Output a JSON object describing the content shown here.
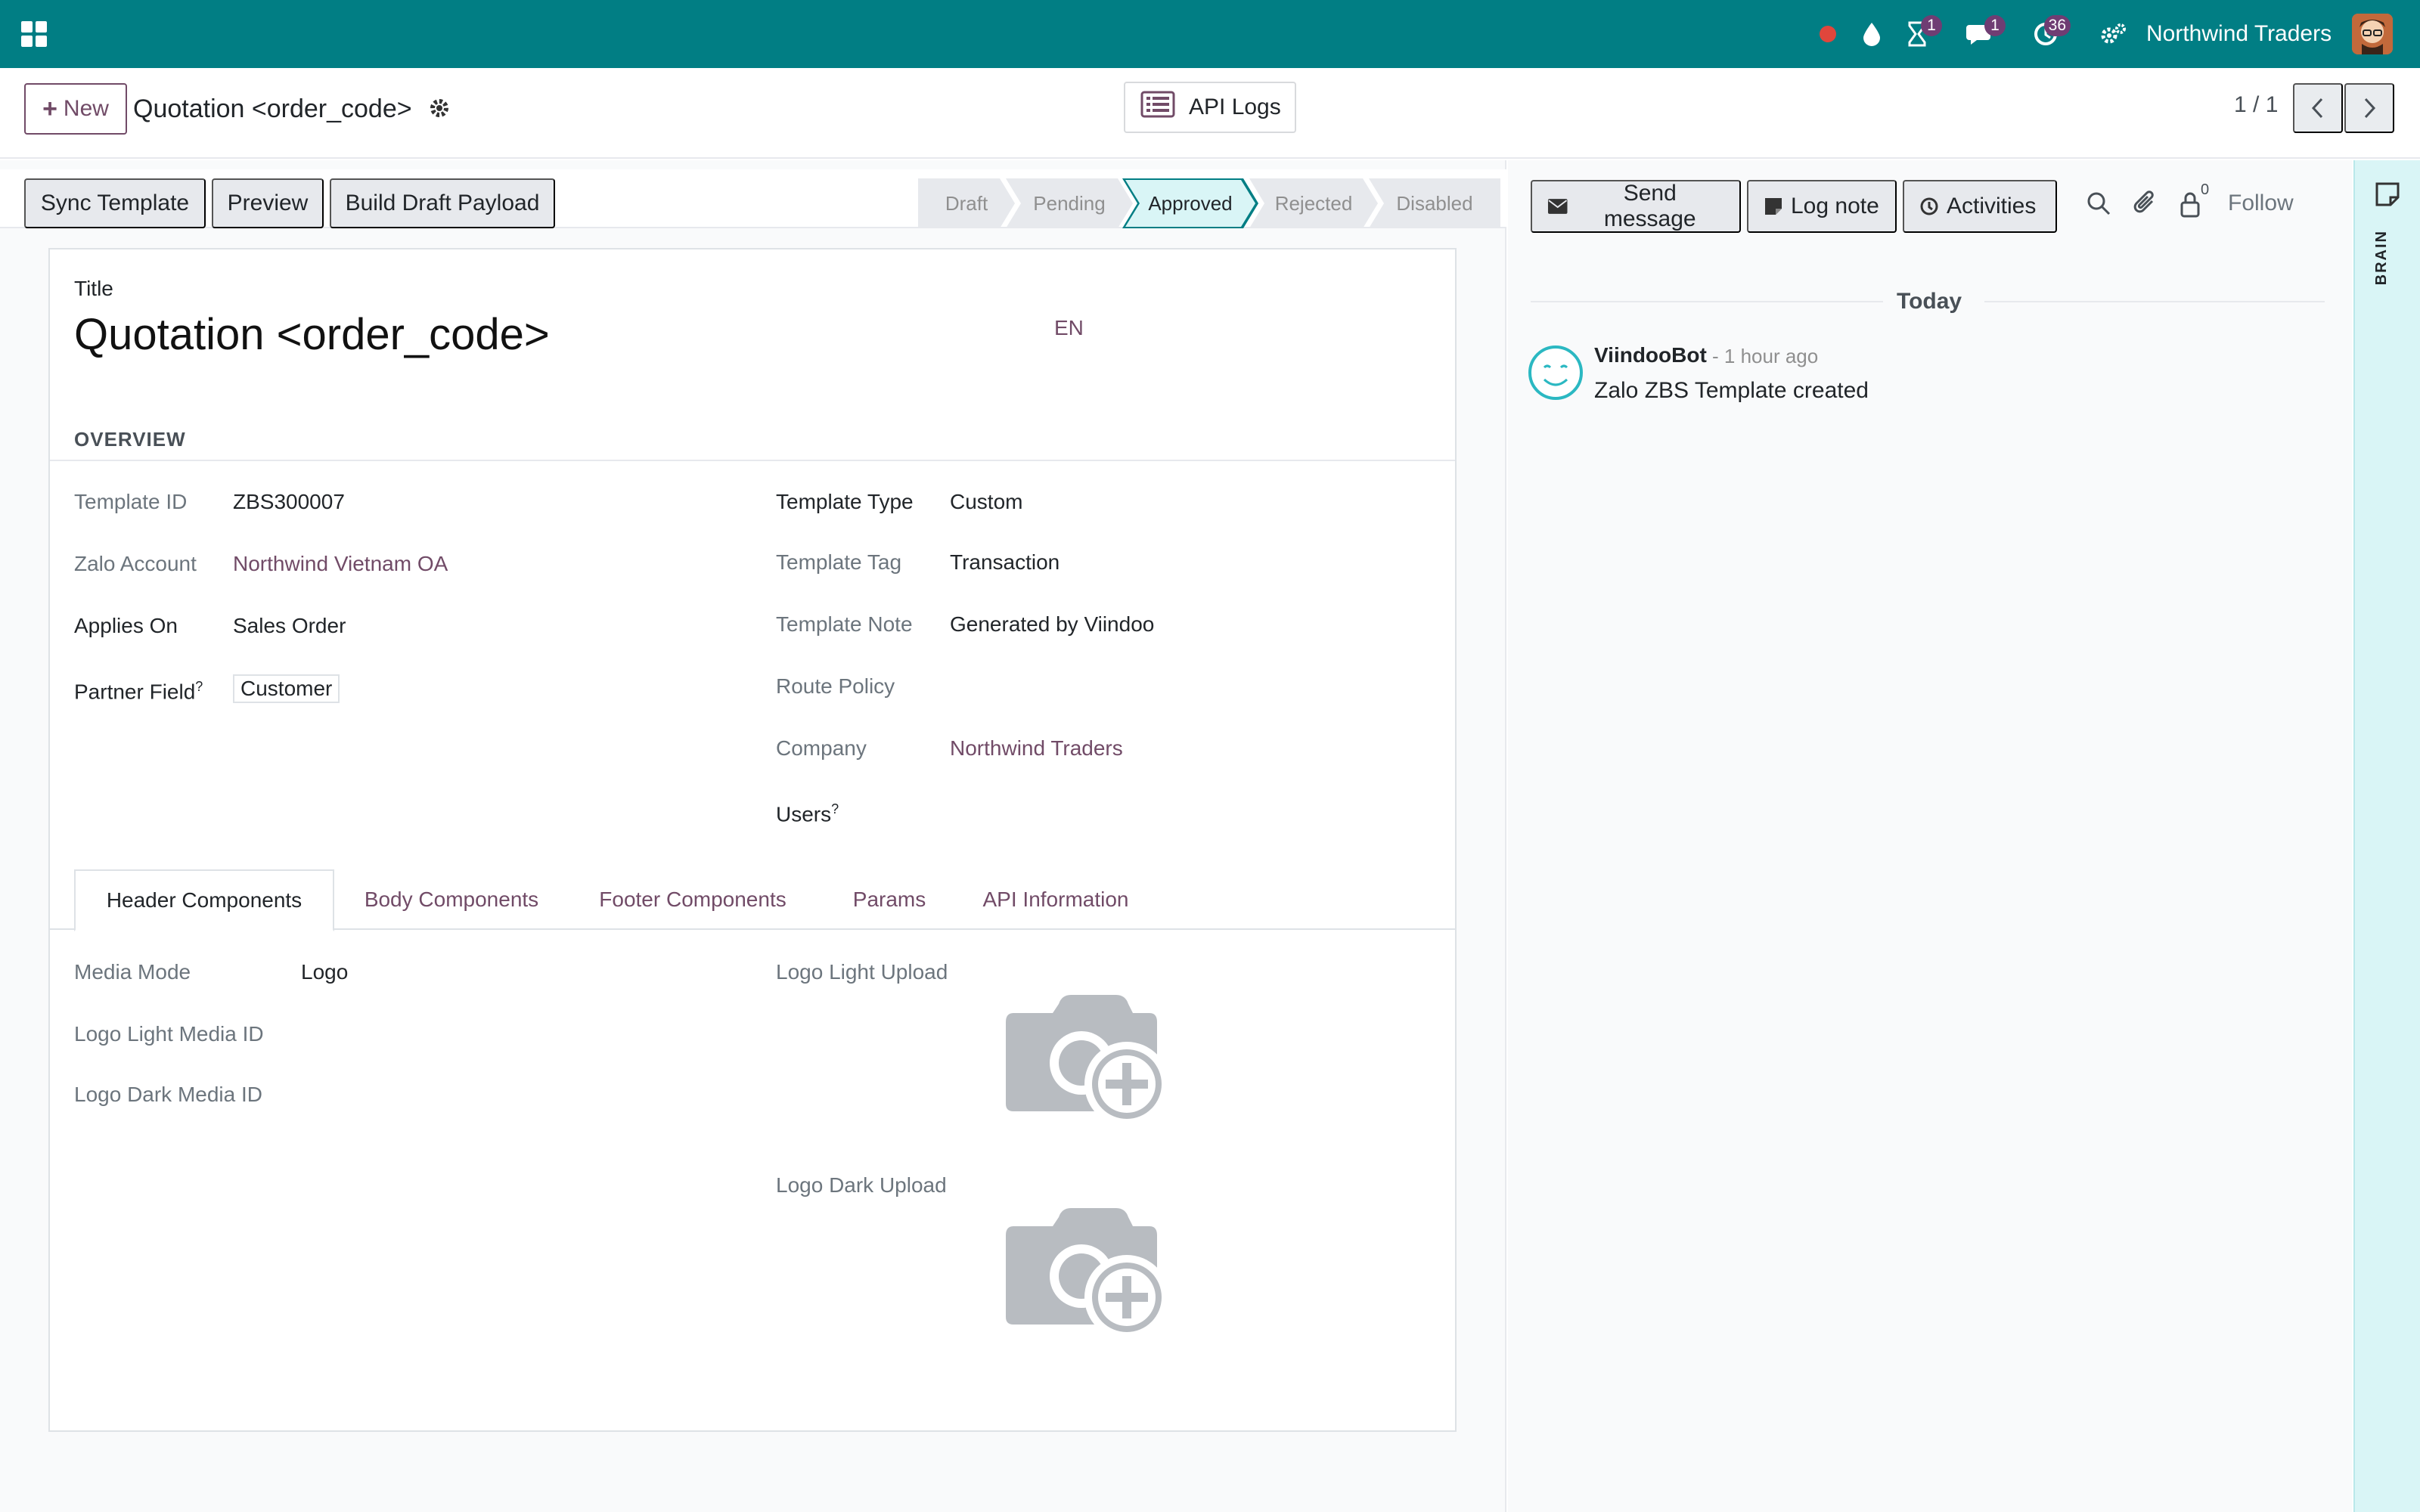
{
  "topbar": {
    "company": "Northwind Traders",
    "badges": {
      "activities": "1",
      "messages": "1",
      "timer": "36"
    }
  },
  "control": {
    "new_label": "New",
    "breadcrumb": "Quotation <order_code>",
    "api_logs_label": "API Logs",
    "pager": "1 / 1"
  },
  "statusbar": {
    "buttons": [
      "Sync Template",
      "Preview",
      "Build Draft Payload"
    ],
    "stages": [
      "Draft",
      "Pending",
      "Approved",
      "Rejected",
      "Disabled"
    ],
    "active_stage": "Approved"
  },
  "form": {
    "title_label": "Title",
    "title": "Quotation <order_code>",
    "lang": "EN",
    "section": "OVERVIEW",
    "left": [
      {
        "label": "Template ID",
        "value": "ZBS300007"
      },
      {
        "label": "Zalo Account",
        "value": "Northwind Vietnam OA"
      },
      {
        "label": "Applies On",
        "value": "Sales Order"
      },
      {
        "label": "Partner Field",
        "value": "Customer"
      }
    ],
    "right": [
      {
        "label": "Template Type",
        "value": "Custom"
      },
      {
        "label": "Template Tag",
        "value": "Transaction"
      },
      {
        "label": "Template Note",
        "value": "Generated by Viindoo"
      },
      {
        "label": "Route Policy",
        "value": ""
      },
      {
        "label": "Company",
        "value": "Northwind Traders"
      },
      {
        "label": "Users",
        "value": ""
      }
    ],
    "help_mark": "?",
    "tabs": [
      "Header Components",
      "Body Components",
      "Footer Components",
      "Params",
      "API Information"
    ],
    "header_tab": {
      "media_mode_label": "Media Mode",
      "media_mode_value": "Logo",
      "light_id_label": "Logo Light Media ID",
      "dark_id_label": "Logo Dark Media ID",
      "light_upload_label": "Logo Light Upload",
      "dark_upload_label": "Logo Dark Upload"
    }
  },
  "chatter": {
    "send_message": "Send message",
    "log_note": "Log note",
    "activities": "Activities",
    "follower_count": "0",
    "follow": "Follow",
    "today": "Today",
    "message": {
      "author": "ViindooBot",
      "time": "- 1 hour ago",
      "body": "Zalo ZBS Template created"
    }
  },
  "side_strip": {
    "label": "BRAIN"
  },
  "colors": {
    "navbar": "#017e84",
    "brand": "#714b67",
    "active_stage_bg": "#d9f5f6"
  }
}
